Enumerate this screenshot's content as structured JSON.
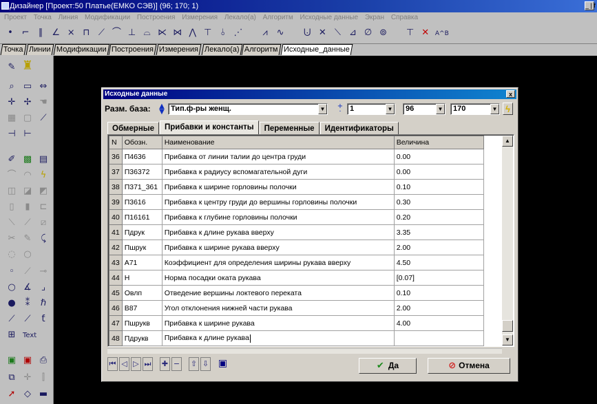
{
  "window": {
    "title": "Дизайнер [Проект:50 Платье(ЕМКО СЭВ)] (96; 170; 1)",
    "minimize_label": "_ | f"
  },
  "menu": [
    "Проект",
    "Точка",
    "Линия",
    "Модификации",
    "Построения",
    "Измерения",
    "Лекало(а)",
    "Алгоритм",
    "Исходные данные",
    "Экран",
    "Справка"
  ],
  "toolbar": {
    "icons": [
      "point-icon",
      "line-tool-icon",
      "parallel-line-icon",
      "angle-icon",
      "cross-icon",
      "rectangle-icon",
      "slope-icon",
      "curve-icon",
      "perpendicular-icon",
      "arc-icon",
      "bisector-icon",
      "intersection-icon",
      "split-icon",
      "tangent-icon",
      "mirror-icon",
      "measure-icon",
      "zigzag-icon",
      "wave-icon",
      "spline-icon",
      "cross-tool-icon",
      "polyline-icon",
      "node-icon",
      "circle-icon",
      "circles-icon",
      "perp-tool-icon",
      "delete-red-x-icon",
      "label-ab-icon"
    ],
    "label_ab": "A^B"
  },
  "tabs": [
    "Точка",
    "Линии",
    "Модификации",
    "Построения",
    "Измерения",
    "Лекало(а)",
    "Алгоритм",
    "Исходные_данные"
  ],
  "palette": {
    "text_tool_label": "Text"
  },
  "dialog": {
    "title": "Исходные данные",
    "close_label": "x",
    "base_label": "Разм. база:",
    "base_type": "Тип.ф-ры женщ.",
    "size_index": "1",
    "size_a": "96",
    "size_b": "170",
    "tabs": [
      "Обмерные",
      "Прибавки и константы",
      "Переменные",
      "Идентификаторы"
    ],
    "active_tab": 1,
    "columns": {
      "n": "N",
      "code": "Обозн.",
      "name": "Наименование",
      "value": "Величина"
    },
    "rows": [
      {
        "n": "36",
        "code": "П4636",
        "name": "Прибавка от линии талии до центра груди",
        "value": "0.00"
      },
      {
        "n": "37",
        "code": "П36372",
        "name": "Прибавка к радиусу вспомагательной дуги",
        "value": "0.00"
      },
      {
        "n": "38",
        "code": "П371_361",
        "name": "Прибавка к ширине горловины полочки",
        "value": "0.10"
      },
      {
        "n": "39",
        "code": "П3616",
        "name": "Прибавка к центру груди до вершины горловины полочки",
        "value": "0.30"
      },
      {
        "n": "40",
        "code": "П16161",
        "name": "Прибавка к глубине горловины полочки",
        "value": "0.20"
      },
      {
        "n": "41",
        "code": "Пдрук",
        "name": "Прибавка к длине рукава вверху",
        "value": "3.35"
      },
      {
        "n": "42",
        "code": "Пшрук",
        "name": "Прибавка к ширине рукава вверху",
        "value": "2.00"
      },
      {
        "n": "43",
        "code": "А71",
        "name": "Коэффициент для определения ширины рукава вверху",
        "value": "4.50"
      },
      {
        "n": "44",
        "code": "Н",
        "name": "Норма посадки оката рукава",
        "value": "[0.07]"
      },
      {
        "n": "45",
        "code": "Овлп",
        "name": "Отведение вершины локтевого переката",
        "value": "0.10"
      },
      {
        "n": "46",
        "code": "В87",
        "name": "Угол отклонения нижней части рукава",
        "value": "2.00"
      },
      {
        "n": "47",
        "code": "Пшрукв",
        "name": "Прибавка к ширине рукава",
        "value": "4.00"
      },
      {
        "n": "48",
        "code": "Пдрукв",
        "name": "Прибавка к длине рукава",
        "value": ""
      }
    ],
    "ok_label": "Да",
    "cancel_label": "Отмена"
  }
}
